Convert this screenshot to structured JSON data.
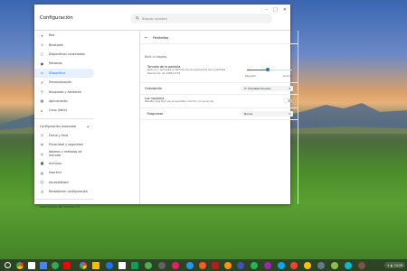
{
  "app": {
    "title": "Configuración"
  },
  "search": {
    "placeholder": "Buscar ajustes"
  },
  "sidebar": {
    "items": [
      {
        "label": "Red",
        "icon": "wifi-icon"
      },
      {
        "label": "Bluetooth",
        "icon": "bluetooth-icon"
      },
      {
        "label": "Dispositivos conectados",
        "icon": "phone-icon"
      },
      {
        "label": "Personas",
        "icon": "person-icon"
      },
      {
        "label": "Dispositivo",
        "icon": "laptop-icon",
        "active": true
      },
      {
        "label": "Personalización",
        "icon": "brush-icon"
      },
      {
        "label": "Búsqueda y Asistente",
        "icon": "search-icon"
      },
      {
        "label": "Aplicaciones",
        "icon": "apps-icon"
      },
      {
        "label": "Linux (beta)",
        "icon": "terminal-icon"
      }
    ],
    "advanced_label": "Configuración avanzada",
    "advanced_items": [
      {
        "label": "Fecha y hora",
        "icon": "clock-icon"
      },
      {
        "label": "Privacidad y seguridad",
        "icon": "shield-icon"
      },
      {
        "label": "Idiomas y métodos de entrada",
        "icon": "globe-icon"
      },
      {
        "label": "Archivos",
        "icon": "folder-icon"
      },
      {
        "label": "Imprimir",
        "icon": "printer-icon"
      },
      {
        "label": "Accesibilidad",
        "icon": "accessibility-icon"
      },
      {
        "label": "Restablecer configuración",
        "icon": "reset-icon"
      }
    ],
    "footer": "Información de Chrome OS"
  },
  "page": {
    "title": "Pantallas",
    "section": "Built-in display",
    "size": {
      "title": "Tamaño de la pantalla",
      "desc1": "Reduce o aumenta el tamaño de los elementos de la pantalla",
      "desc2": "Resolución de 1366x1776",
      "min_label": "Pequeño",
      "max_label": "Grande",
      "level": 0.45
    },
    "orientation": {
      "title": "Orientación",
      "value": "0° (Predeterminado)"
    },
    "night_light": {
      "title": "Luz nocturna",
      "desc": "Resulta más fácil ver la pantalla o dormir con poca luz",
      "enabled": false
    },
    "schedule": {
      "title": "Programar",
      "value": "Nunca"
    }
  },
  "tray": {
    "time": "14:29"
  },
  "colors": {
    "accent": "#1a73e8"
  }
}
